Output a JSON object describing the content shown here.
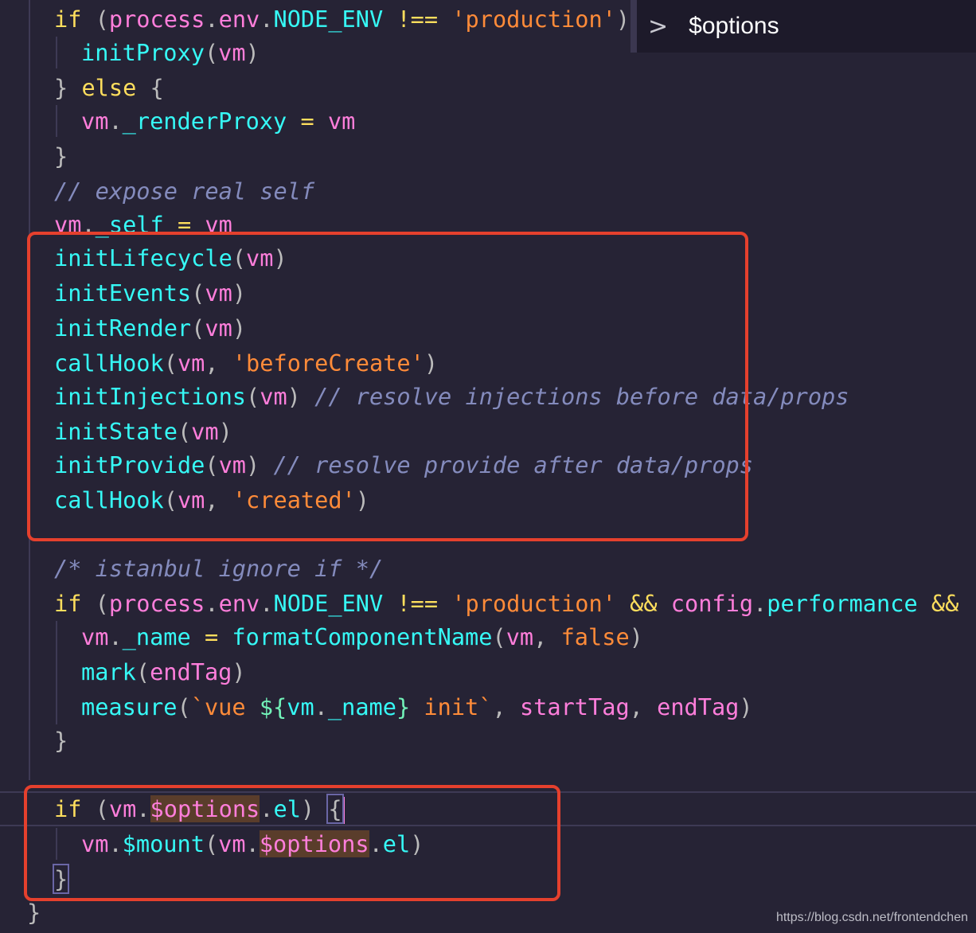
{
  "breadcrumb": {
    "chevron": ">",
    "symbol": "$options"
  },
  "watermark": "https://blog.csdn.net/frontendchen",
  "code_lines": [
    [
      {
        "t": "if",
        "c": "kw"
      },
      {
        "t": " (",
        "c": "pu"
      },
      {
        "t": "process",
        "c": "vm"
      },
      {
        "t": ".",
        "c": "pu"
      },
      {
        "t": "env",
        "c": "vm"
      },
      {
        "t": ".",
        "c": "pu"
      },
      {
        "t": "NODE_ENV",
        "c": "fn"
      },
      {
        "t": " ",
        "c": "pu"
      },
      {
        "t": "!==",
        "c": "kw"
      },
      {
        "t": " ",
        "c": "pu"
      },
      {
        "t": "'production'",
        "c": "str"
      },
      {
        "t": ")",
        "c": "pu"
      }
    ],
    [
      {
        "t": "initProxy",
        "c": "fn"
      },
      {
        "t": "(",
        "c": "pu"
      },
      {
        "t": "vm",
        "c": "vm"
      },
      {
        "t": ")",
        "c": "pu"
      }
    ],
    [
      {
        "t": "} ",
        "c": "pu"
      },
      {
        "t": "else",
        "c": "kw"
      },
      {
        "t": " {",
        "c": "pu"
      }
    ],
    [
      {
        "t": "vm",
        "c": "vm"
      },
      {
        "t": ".",
        "c": "pu"
      },
      {
        "t": "_renderProxy",
        "c": "fn"
      },
      {
        "t": " ",
        "c": "pu"
      },
      {
        "t": "=",
        "c": "kw"
      },
      {
        "t": " ",
        "c": "pu"
      },
      {
        "t": "vm",
        "c": "vm"
      }
    ],
    [
      {
        "t": "}",
        "c": "pu"
      }
    ],
    [
      {
        "t": "// expose real self",
        "c": "cm"
      }
    ],
    [
      {
        "t": "vm",
        "c": "vm"
      },
      {
        "t": ".",
        "c": "pu"
      },
      {
        "t": "_self",
        "c": "fn"
      },
      {
        "t": " ",
        "c": "pu"
      },
      {
        "t": "=",
        "c": "kw"
      },
      {
        "t": " ",
        "c": "pu"
      },
      {
        "t": "vm",
        "c": "vm"
      }
    ],
    [
      {
        "t": "initLifecycle",
        "c": "fn"
      },
      {
        "t": "(",
        "c": "pu"
      },
      {
        "t": "vm",
        "c": "vm"
      },
      {
        "t": ")",
        "c": "pu"
      }
    ],
    [
      {
        "t": "initEvents",
        "c": "fn"
      },
      {
        "t": "(",
        "c": "pu"
      },
      {
        "t": "vm",
        "c": "vm"
      },
      {
        "t": ")",
        "c": "pu"
      }
    ],
    [
      {
        "t": "initRender",
        "c": "fn"
      },
      {
        "t": "(",
        "c": "pu"
      },
      {
        "t": "vm",
        "c": "vm"
      },
      {
        "t": ")",
        "c": "pu"
      }
    ],
    [
      {
        "t": "callHook",
        "c": "fn"
      },
      {
        "t": "(",
        "c": "pu"
      },
      {
        "t": "vm",
        "c": "vm"
      },
      {
        "t": ", ",
        "c": "pu"
      },
      {
        "t": "'beforeCreate'",
        "c": "str"
      },
      {
        "t": ")",
        "c": "pu"
      }
    ],
    [
      {
        "t": "initInjections",
        "c": "fn"
      },
      {
        "t": "(",
        "c": "pu"
      },
      {
        "t": "vm",
        "c": "vm"
      },
      {
        "t": ") ",
        "c": "pu"
      },
      {
        "t": "// resolve injections before data/props",
        "c": "cm"
      }
    ],
    [
      {
        "t": "initState",
        "c": "fn"
      },
      {
        "t": "(",
        "c": "pu"
      },
      {
        "t": "vm",
        "c": "vm"
      },
      {
        "t": ")",
        "c": "pu"
      }
    ],
    [
      {
        "t": "initProvide",
        "c": "fn"
      },
      {
        "t": "(",
        "c": "pu"
      },
      {
        "t": "vm",
        "c": "vm"
      },
      {
        "t": ") ",
        "c": "pu"
      },
      {
        "t": "// resolve provide after data/props",
        "c": "cm"
      }
    ],
    [
      {
        "t": "callHook",
        "c": "fn"
      },
      {
        "t": "(",
        "c": "pu"
      },
      {
        "t": "vm",
        "c": "vm"
      },
      {
        "t": ", ",
        "c": "pu"
      },
      {
        "t": "'created'",
        "c": "str"
      },
      {
        "t": ")",
        "c": "pu"
      }
    ],
    [],
    [
      {
        "t": "/* istanbul ignore if */",
        "c": "cm"
      }
    ],
    [
      {
        "t": "if",
        "c": "kw"
      },
      {
        "t": " (",
        "c": "pu"
      },
      {
        "t": "process",
        "c": "vm"
      },
      {
        "t": ".",
        "c": "pu"
      },
      {
        "t": "env",
        "c": "vm"
      },
      {
        "t": ".",
        "c": "pu"
      },
      {
        "t": "NODE_ENV",
        "c": "fn"
      },
      {
        "t": " ",
        "c": "pu"
      },
      {
        "t": "!==",
        "c": "kw"
      },
      {
        "t": " ",
        "c": "pu"
      },
      {
        "t": "'production'",
        "c": "str"
      },
      {
        "t": " ",
        "c": "pu"
      },
      {
        "t": "&&",
        "c": "kw"
      },
      {
        "t": " ",
        "c": "pu"
      },
      {
        "t": "config",
        "c": "vm"
      },
      {
        "t": ".",
        "c": "pu"
      },
      {
        "t": "performance",
        "c": "fn"
      },
      {
        "t": " ",
        "c": "pu"
      },
      {
        "t": "&&",
        "c": "kw"
      }
    ],
    [
      {
        "t": "vm",
        "c": "vm"
      },
      {
        "t": ".",
        "c": "pu"
      },
      {
        "t": "_name",
        "c": "fn"
      },
      {
        "t": " ",
        "c": "pu"
      },
      {
        "t": "=",
        "c": "kw"
      },
      {
        "t": " ",
        "c": "pu"
      },
      {
        "t": "formatComponentName",
        "c": "fn"
      },
      {
        "t": "(",
        "c": "pu"
      },
      {
        "t": "vm",
        "c": "vm"
      },
      {
        "t": ", ",
        "c": "pu"
      },
      {
        "t": "false",
        "c": "str"
      },
      {
        "t": ")",
        "c": "pu"
      }
    ],
    [
      {
        "t": "mark",
        "c": "fn"
      },
      {
        "t": "(",
        "c": "pu"
      },
      {
        "t": "endTag",
        "c": "vm"
      },
      {
        "t": ")",
        "c": "pu"
      }
    ],
    [
      {
        "t": "measure",
        "c": "fn"
      },
      {
        "t": "(",
        "c": "pu"
      },
      {
        "t": "`vue ",
        "c": "str"
      },
      {
        "t": "${",
        "c": "tpl"
      },
      {
        "t": "vm",
        "c": "fn"
      },
      {
        "t": ".",
        "c": "pu"
      },
      {
        "t": "_name",
        "c": "fn"
      },
      {
        "t": "}",
        "c": "tpl"
      },
      {
        "t": " init`",
        "c": "str"
      },
      {
        "t": ", ",
        "c": "pu"
      },
      {
        "t": "startTag",
        "c": "vm"
      },
      {
        "t": ", ",
        "c": "pu"
      },
      {
        "t": "endTag",
        "c": "vm"
      },
      {
        "t": ")",
        "c": "pu"
      }
    ],
    [
      {
        "t": "}",
        "c": "pu"
      }
    ],
    [],
    [
      {
        "t": "if",
        "c": "kw"
      },
      {
        "t": " (",
        "c": "pu"
      },
      {
        "t": "vm",
        "c": "vm"
      },
      {
        "t": ".",
        "c": "pu"
      },
      {
        "t": "$options",
        "c": "vm",
        "hl": true
      },
      {
        "t": ".",
        "c": "pu"
      },
      {
        "t": "el",
        "c": "fn"
      },
      {
        "t": ") ",
        "c": "pu"
      },
      {
        "t": "{",
        "c": "pu",
        "bm": true
      }
    ],
    [
      {
        "t": "vm",
        "c": "vm"
      },
      {
        "t": ".",
        "c": "pu"
      },
      {
        "t": "$mount",
        "c": "fn"
      },
      {
        "t": "(",
        "c": "pu"
      },
      {
        "t": "vm",
        "c": "vm"
      },
      {
        "t": ".",
        "c": "pu"
      },
      {
        "t": "$options",
        "c": "vm",
        "hl": true
      },
      {
        "t": ".",
        "c": "pu"
      },
      {
        "t": "el",
        "c": "fn"
      },
      {
        "t": ")",
        "c": "pu"
      }
    ],
    [
      {
        "t": "}",
        "c": "pu",
        "bm": true
      }
    ],
    [
      {
        "t": "}",
        "c": "pu"
      }
    ]
  ]
}
